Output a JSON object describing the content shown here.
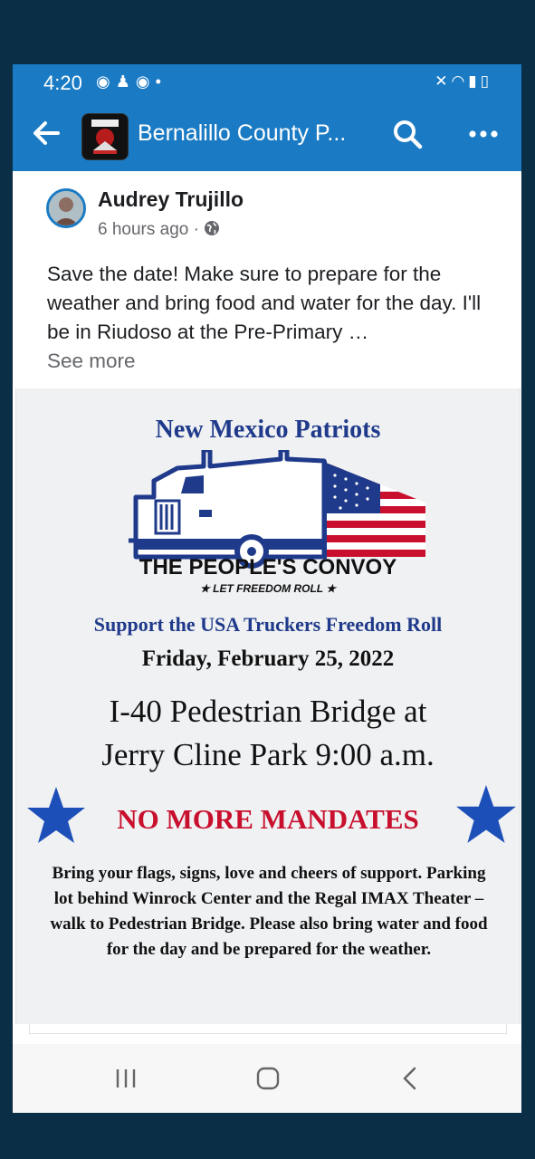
{
  "status_bar": {
    "time": "4:20",
    "left_icons": [
      "messenger-icon",
      "notification-icon",
      "messenger-icon",
      "dot-icon"
    ],
    "right_icons": [
      "mute-vibrate-icon",
      "wifi-icon",
      "signal-icon",
      "battery-charging-icon"
    ]
  },
  "app_bar": {
    "title": "Bernalillo County P...",
    "color": "#1a7bc4"
  },
  "post": {
    "author": "Audrey Trujillo",
    "time": "6 hours ago",
    "separator": "·",
    "body": "Save the date! Make sure to prepare for the weather and bring food and water for the day. I'll be in Riudoso at the Pre-Primary …",
    "see_more": "See more"
  },
  "flyer": {
    "heading": "New Mexico Patriots",
    "convoy_title": "THE PEOPLE'S CONVOY",
    "convoy_tagline": "★ LET FREEDOM ROLL ★",
    "support_line": "Support the USA Truckers Freedom Roll",
    "date": "Friday, February 25, 2022",
    "location_line1": "I-40 Pedestrian Bridge at",
    "location_line2": "Jerry Cline Park 9:00 a.m.",
    "mandates": "NO MORE MANDATES",
    "details": "Bring your flags, signs, love and cheers of support. Parking lot behind Winrock Center and the Regal IMAX Theater – walk to Pedestrian Bridge.  Please also bring water and food for the day and be prepared for the weather.",
    "colors": {
      "navy": "#1f3a8a",
      "red": "#c8102e",
      "star_blue": "#1d4fb8"
    }
  },
  "nav_bar": {
    "buttons": [
      "recents-icon",
      "home-icon",
      "back-icon"
    ]
  }
}
